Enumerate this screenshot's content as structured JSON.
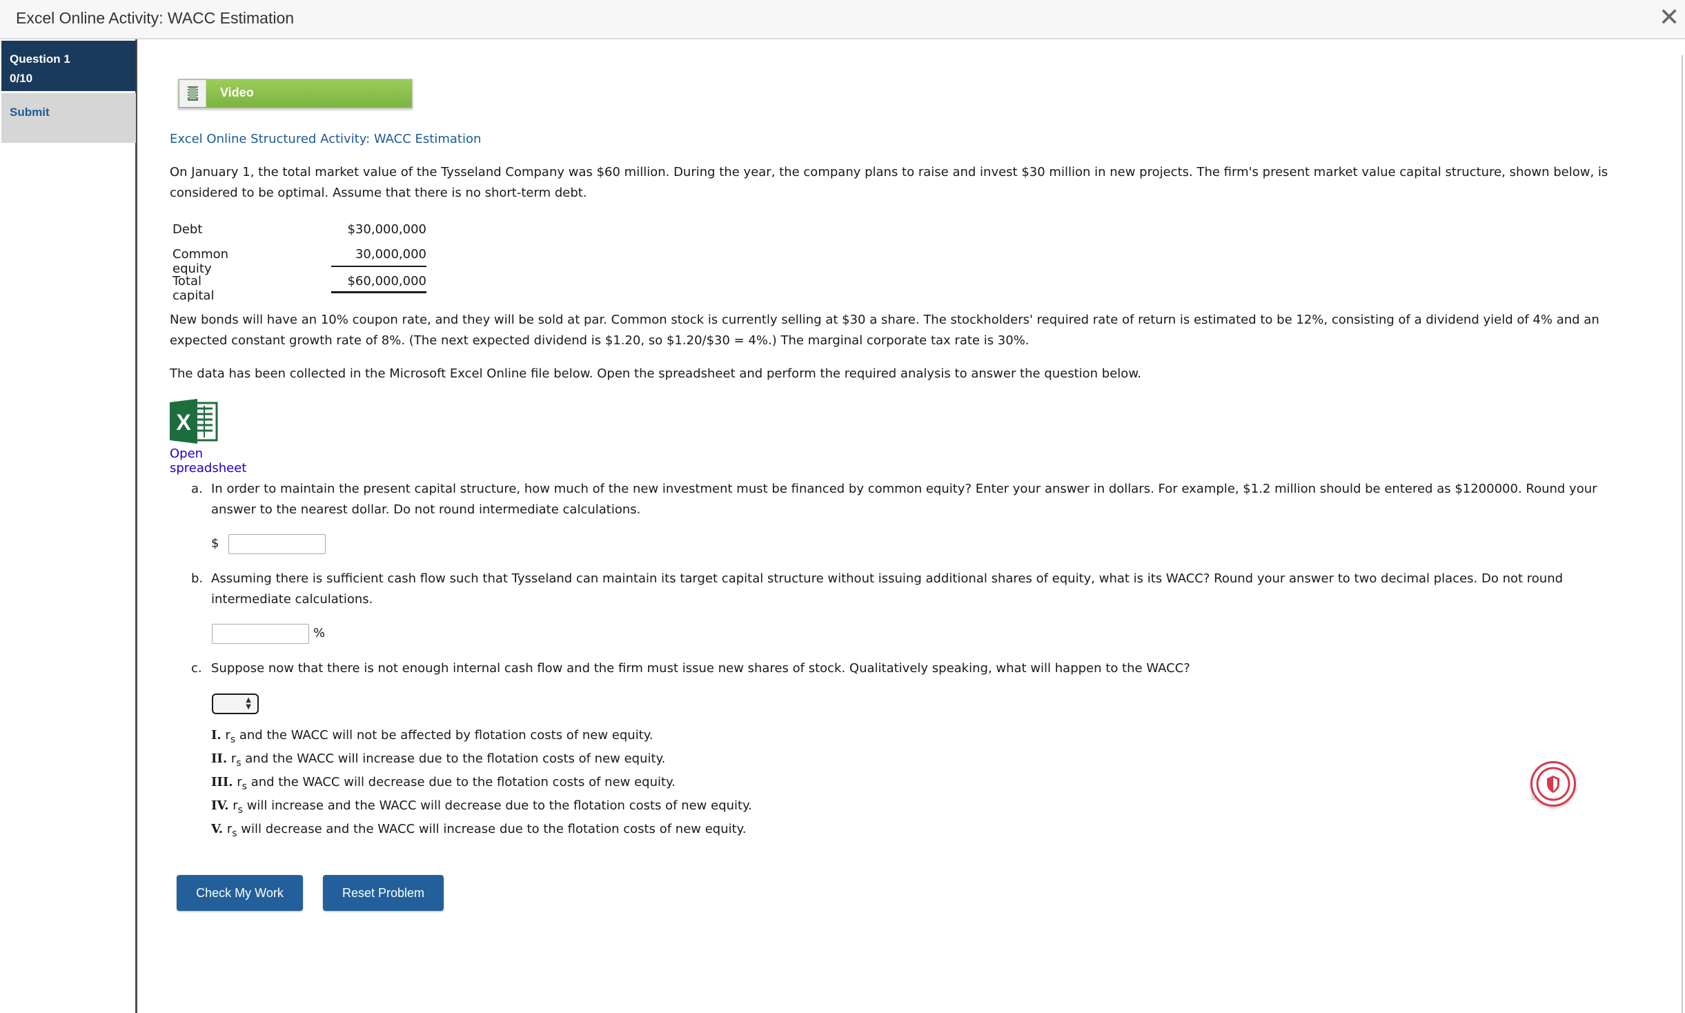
{
  "window": {
    "title": "Excel Online Activity: WACC Estimation"
  },
  "sidebar": {
    "question_label": "Question 1",
    "score": "0/10",
    "submit_label": "Submit"
  },
  "video_button": {
    "label": "Video"
  },
  "activity": {
    "heading": "Excel Online Structured Activity: WACC Estimation",
    "intro_lines": [
      "On January 1, the total market value of the Tysseland Company was $60 million. During the year, the company plans to raise and invest $30 million in new projects. The firm's present market value capital structure, shown below, is",
      "considered to be optimal. Assume that there is no short-term debt."
    ],
    "capital_structure": [
      {
        "label": "Debt",
        "value": "$30,000,000"
      },
      {
        "label": "Common equity",
        "value": "30,000,000"
      },
      {
        "label": "Total capital",
        "value": "$60,000,000"
      }
    ],
    "bonds_lines": [
      "New bonds will have an 10% coupon rate, and they will be sold at par. Common stock is currently selling at $30 a share. The stockholders' required rate of return is estimated to be 12%, consisting of a dividend yield of 4% and an",
      "expected constant growth rate of 8%. (The next expected dividend is $1.20, so $1.20/$30 = 4%.) The marginal corporate tax rate is 30%."
    ],
    "data_note": "The data has been collected in the Microsoft Excel Online file below. Open the spreadsheet and perform the required analysis to answer the question below.",
    "open_spreadsheet": "Open spreadsheet"
  },
  "questions": {
    "a": {
      "letter": "a.",
      "lines": [
        "In order to maintain the present capital structure, how much of the new investment must be financed by common equity? Enter your answer in dollars. For example, $1.2 million should be entered as $1200000. Round your",
        "answer to the nearest dollar. Do not round intermediate calculations."
      ],
      "prefix": "$",
      "value": ""
    },
    "b": {
      "letter": "b.",
      "lines": [
        "Assuming there is sufficient cash flow such that Tysseland can maintain its target capital structure without issuing additional shares of equity, what is its WACC? Round your answer to two decimal places. Do not round",
        "intermediate calculations."
      ],
      "suffix": "%",
      "value": ""
    },
    "c": {
      "letter": "c.",
      "text": "Suppose now that there is not enough internal cash flow and the firm must issue new shares of stock. Qualitatively speaking, what will happen to the WACC?",
      "selected": "",
      "options": [
        {
          "num": "I.",
          "r": "r",
          "sub": "s",
          "text": "and the WACC will not be affected by flotation costs of new equity."
        },
        {
          "num": "II.",
          "r": "r",
          "sub": "s",
          "text": "and the WACC will increase due to the flotation costs of new equity."
        },
        {
          "num": "III.",
          "r": "r",
          "sub": "s",
          "text": "and the WACC will decrease due to the flotation costs of new equity."
        },
        {
          "num": "IV.",
          "r": "r",
          "sub": "s",
          "text": "will increase and the WACC will decrease due to the flotation costs of new equity."
        },
        {
          "num": "V.",
          "r": "r",
          "sub": "s",
          "text": "will decrease and the WACC will increase due to the flotation costs of new equity."
        }
      ]
    }
  },
  "buttons": {
    "check": "Check My Work",
    "reset": "Reset Problem"
  },
  "icons": {
    "close": "close-icon",
    "film": "film-icon",
    "excel": "excel-icon",
    "shield": "shield-icon",
    "drag": "drag-handle-icon"
  },
  "colors": {
    "sidebar_active": "#1a3a5c",
    "link": "#1d5a94",
    "video_green": "#8bc34a",
    "button_blue": "#23609b",
    "excel_green": "#1e6e3d",
    "shield_red": "#d63a4a"
  }
}
